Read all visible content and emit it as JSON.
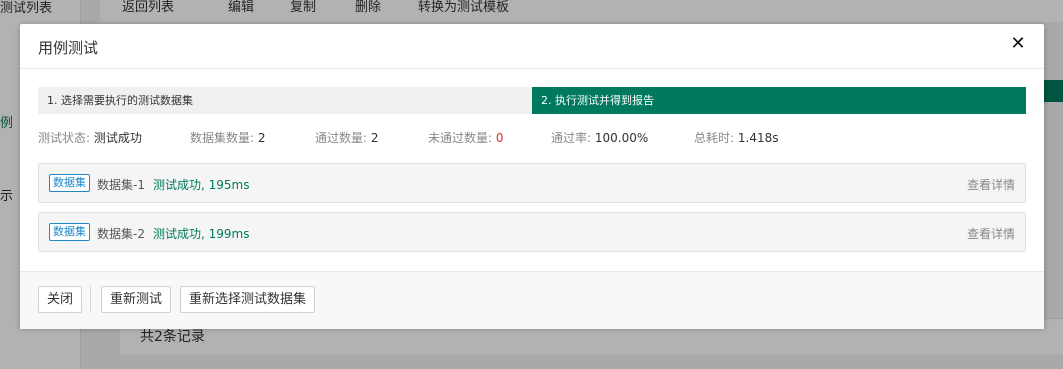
{
  "background": {
    "sidebar_items": [
      "测试列表",
      "例",
      "示"
    ],
    "toolbar": [
      "返回列表",
      "编辑",
      "复制",
      "删除",
      "转换为测试模板"
    ],
    "footer_text": "共2条记录"
  },
  "modal": {
    "title": "用例测试",
    "close_icon": "close-icon",
    "steps": [
      {
        "label": "1. 选择需要执行的测试数据集",
        "active": false
      },
      {
        "label": "2. 执行测试并得到报告",
        "active": true
      }
    ],
    "stats": {
      "status_label": "测试状态:",
      "status_value": "测试成功",
      "dataset_count_label": "数据集数量:",
      "dataset_count_value": "2",
      "pass_count_label": "通过数量:",
      "pass_count_value": "2",
      "fail_count_label": "未通过数量:",
      "fail_count_value": "0",
      "pass_rate_label": "通过率:",
      "pass_rate_value": "100.00%",
      "duration_label": "总耗时:",
      "duration_value": "1.418s"
    },
    "datasets": [
      {
        "tag": "数据集",
        "name": "数据集-1",
        "result": "测试成功, 195ms",
        "detail": "查看详情"
      },
      {
        "tag": "数据集",
        "name": "数据集-2",
        "result": "测试成功, 199ms",
        "detail": "查看详情"
      }
    ],
    "footer": {
      "close_label": "关闭",
      "retest_label": "重新测试",
      "reselect_label": "重新选择测试数据集"
    }
  },
  "colors": {
    "accent": "#007a5e",
    "tag_blue": "#1e88c8",
    "fail_red": "#e0302a"
  }
}
